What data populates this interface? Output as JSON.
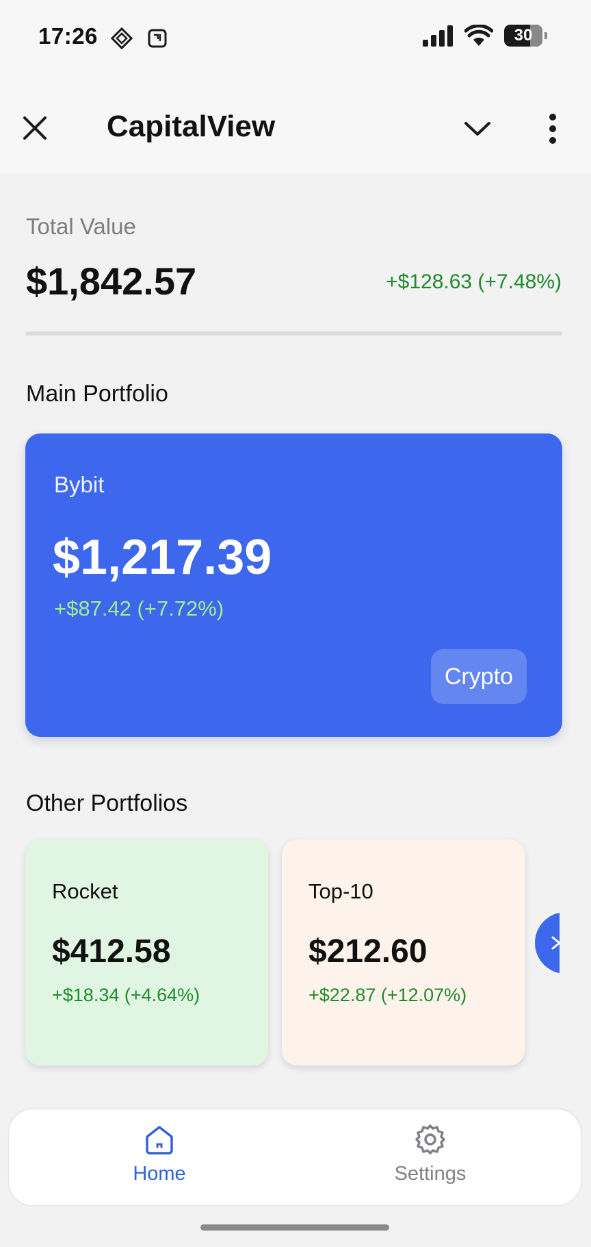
{
  "status_bar": {
    "time": "17:26",
    "battery": "30",
    "icons": [
      "navigation-diamond-icon",
      "notification-app-icon",
      "signal-icon",
      "wifi-icon",
      "battery-icon"
    ]
  },
  "app_bar": {
    "title": "CapitalView",
    "close_icon": "close-icon",
    "dropdown_icon": "chevron-down-icon",
    "menu_icon": "more-vertical-icon"
  },
  "summary": {
    "label": "Total Value",
    "value": "$1,842.57",
    "change": "+$128.63 (+7.48%)"
  },
  "main_portfolio": {
    "section_title": "Main Portfolio",
    "name": "Bybit",
    "value": "$1,217.39",
    "change": "+$87.42 (+7.72%)",
    "tag": "Crypto",
    "color": "#3d68ee"
  },
  "other_portfolios": {
    "section_title": "Other Portfolios",
    "items": [
      {
        "name": "Rocket",
        "value": "$412.58",
        "change": "+$18.34 (+4.64%)",
        "background": "#e0f6e2"
      },
      {
        "name": "Top-10",
        "value": "$212.60",
        "change": "+$22.87 (+12.07%)",
        "background": "#fdf3ea"
      }
    ],
    "next_icon": "chevron-right-icon"
  },
  "bottom_nav": {
    "items": [
      {
        "label": "Home",
        "icon": "home-icon",
        "active": true
      },
      {
        "label": "Settings",
        "icon": "gear-icon",
        "active": false
      }
    ]
  },
  "colors": {
    "positive": "#1f8a2c",
    "positive_on_blue": "#9ef08f",
    "accent": "#3d68ee",
    "nav_active": "#3262d8",
    "nav_inactive": "#808085"
  }
}
